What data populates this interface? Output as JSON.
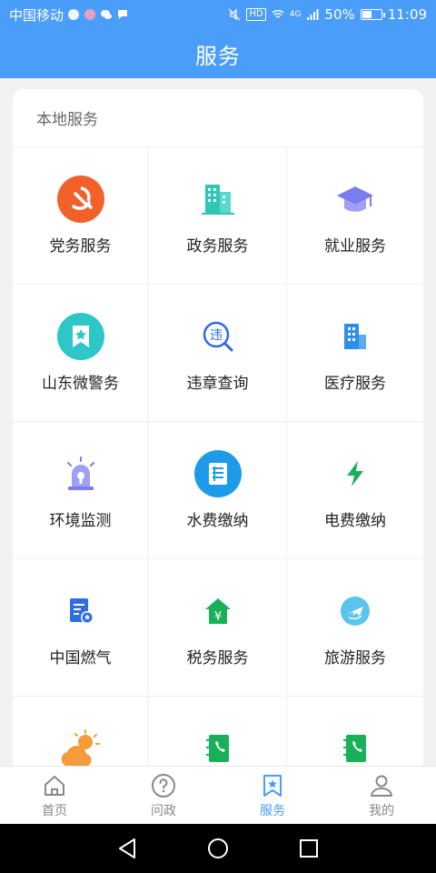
{
  "status_bar": {
    "carrier": "中国移动",
    "network": "4G",
    "battery": "50%",
    "battery_level": 0.5,
    "time": "11:09",
    "hd": "HD"
  },
  "header": {
    "title": "服务"
  },
  "section": {
    "title": "本地服务"
  },
  "services": [
    {
      "label": "党务服务",
      "icon": "party-emblem-icon"
    },
    {
      "label": "政务服务",
      "icon": "building-icon"
    },
    {
      "label": "就业服务",
      "icon": "graduation-cap-icon"
    },
    {
      "label": "山东微警务",
      "icon": "police-badge-icon"
    },
    {
      "label": "违章查询",
      "icon": "violation-search-icon"
    },
    {
      "label": "医疗服务",
      "icon": "hospital-icon"
    },
    {
      "label": "环境监测",
      "icon": "alarm-light-icon"
    },
    {
      "label": "水费缴纳",
      "icon": "water-bill-icon"
    },
    {
      "label": "电费缴纳",
      "icon": "lightning-icon"
    },
    {
      "label": "中国燃气",
      "icon": "gas-bill-icon"
    },
    {
      "label": "税务服务",
      "icon": "tax-house-icon"
    },
    {
      "label": "旅游服务",
      "icon": "travel-plane-icon"
    },
    {
      "label": "",
      "icon": "weather-icon"
    },
    {
      "label": "",
      "icon": "phone-book-icon"
    },
    {
      "label": "",
      "icon": "phone-book-icon"
    }
  ],
  "bottom_nav": [
    {
      "label": "首页",
      "icon": "home-icon",
      "active": false
    },
    {
      "label": "问政",
      "icon": "question-icon",
      "active": false
    },
    {
      "label": "服务",
      "icon": "service-bookmark-icon",
      "active": true
    },
    {
      "label": "我的",
      "icon": "user-icon",
      "active": false
    }
  ],
  "colors": {
    "primary": "#4a9df8",
    "party_red": "#f2612a",
    "teal": "#2ec7b6",
    "purple": "#7b7cf0",
    "blue": "#2f6de0",
    "green": "#1ab05a",
    "orange": "#f59b3a"
  }
}
